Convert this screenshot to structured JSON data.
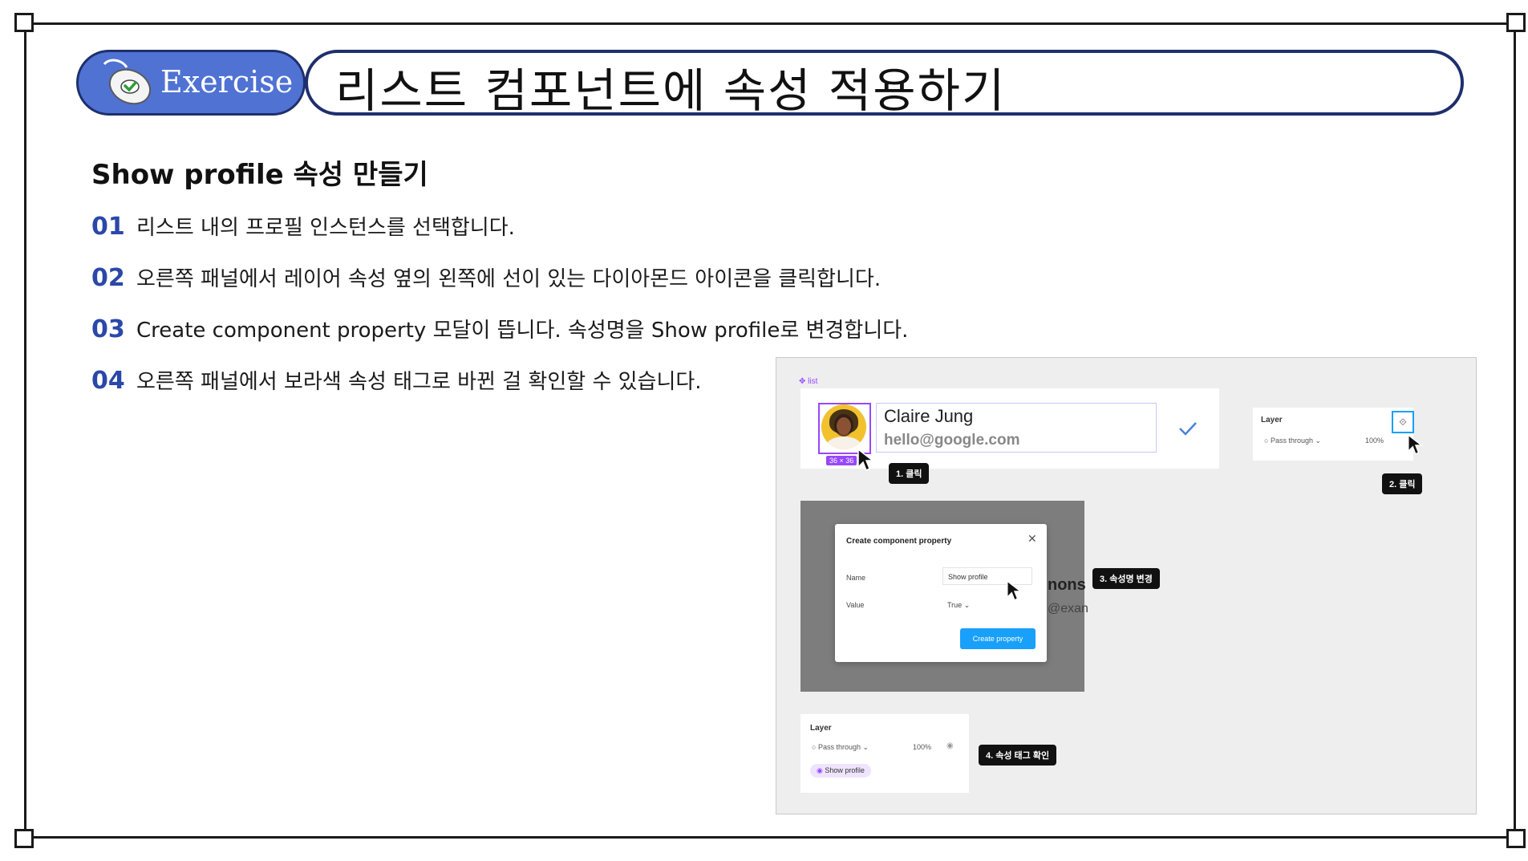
{
  "badge": {
    "label": "Exercise"
  },
  "title": "리스트 컴포넌트에 속성 적용하기",
  "section": {
    "heading": "Show profile 속성 만들기",
    "steps": [
      {
        "num": "01",
        "text": "리스트 내의 프로필 인스턴스를 선택합니다."
      },
      {
        "num": "02",
        "text": "오른쪽 패널에서 레이어 속성 옆의 왼쪽에 선이 있는 다이아몬드 아이콘을 클릭합니다."
      },
      {
        "num": "03",
        "text": "Create component property 모달이 뜹니다. 속성명을 Show profile로 변경합니다."
      },
      {
        "num": "04",
        "text": "오른쪽 패널에서 보라색 속성 태그로 바뀐 걸 확인할 수 있습니다."
      }
    ]
  },
  "screenshot": {
    "list_label": "list",
    "profile": {
      "name": "Claire Jung",
      "email": "hello@google.com",
      "size_badge": "36 × 36"
    },
    "tags": {
      "t1": "1. 클릭",
      "t2": "2. 클릭",
      "t3": "3. 속성명 변경",
      "t4": "4. 속성 태그 확인"
    },
    "layer_panel_top": {
      "title": "Layer",
      "mode": "Pass through",
      "opacity": "100%"
    },
    "modal": {
      "title": "Create component property",
      "name_label": "Name",
      "name_value": "Show profile",
      "value_label": "Value",
      "value_value": "True",
      "button": "Create property"
    },
    "behind_text": {
      "line1": "nons",
      "line2": "@exan"
    },
    "layer_panel_bottom": {
      "title": "Layer",
      "mode": "Pass through",
      "opacity": "100%",
      "property_tag": "Show profile"
    },
    "colors": {
      "accent_blue": "#18a0fb",
      "purple": "#9747ff",
      "tag_bg": "#111111"
    }
  }
}
